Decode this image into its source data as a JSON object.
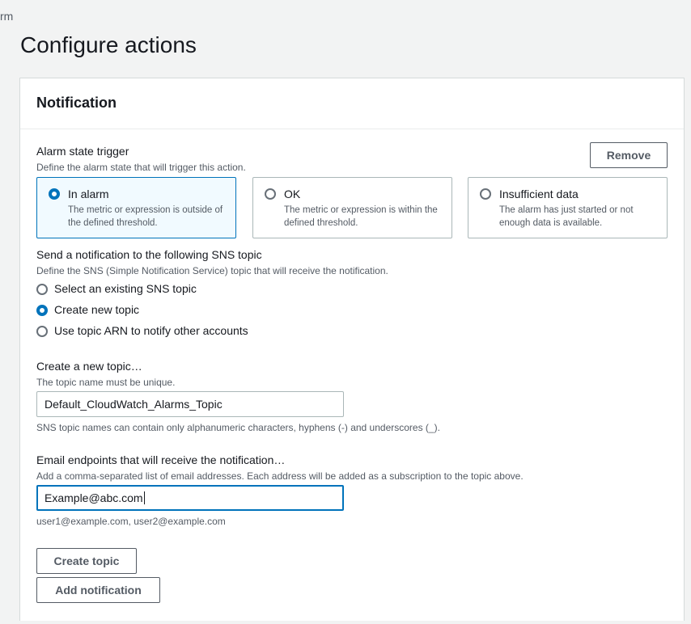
{
  "breadcrumb": "rm",
  "page_title": "Configure actions",
  "panel": {
    "title": "Notification",
    "remove_label": "Remove"
  },
  "alarm_state": {
    "label": "Alarm state trigger",
    "description": "Define the alarm state that will trigger this action.",
    "options": [
      {
        "title": "In alarm",
        "description": "The metric or expression is outside of the defined threshold.",
        "selected": true
      },
      {
        "title": "OK",
        "description": "The metric or expression is within the defined threshold.",
        "selected": false
      },
      {
        "title": "Insufficient data",
        "description": "The alarm has just started or not enough data is available.",
        "selected": false
      }
    ]
  },
  "sns": {
    "label": "Send a notification to the following SNS topic",
    "description": "Define the SNS (Simple Notification Service) topic that will receive the notification.",
    "options": [
      {
        "label": "Select an existing SNS topic",
        "selected": false
      },
      {
        "label": "Create new topic",
        "selected": true
      },
      {
        "label": "Use topic ARN to notify other accounts",
        "selected": false
      }
    ]
  },
  "new_topic": {
    "label": "Create a new topic…",
    "description": "The topic name must be unique.",
    "value": "Default_CloudWatch_Alarms_Topic",
    "constraint": "SNS topic names can contain only alphanumeric characters, hyphens (-) and underscores (_)."
  },
  "email": {
    "label": "Email endpoints that will receive the notification…",
    "description": "Add a comma-separated list of email addresses. Each address will be added as a subscription to the topic above.",
    "value": "Example@abc.com",
    "hint": "user1@example.com, user2@example.com"
  },
  "buttons": {
    "create_topic": "Create topic",
    "add_notification": "Add notification"
  },
  "colors": {
    "accent": "#0073bb",
    "background": "#f2f3f3",
    "text": "#16191f",
    "muted": "#545b64"
  },
  "icons": [
    "radio-selected-icon",
    "radio-unselected-icon"
  ]
}
